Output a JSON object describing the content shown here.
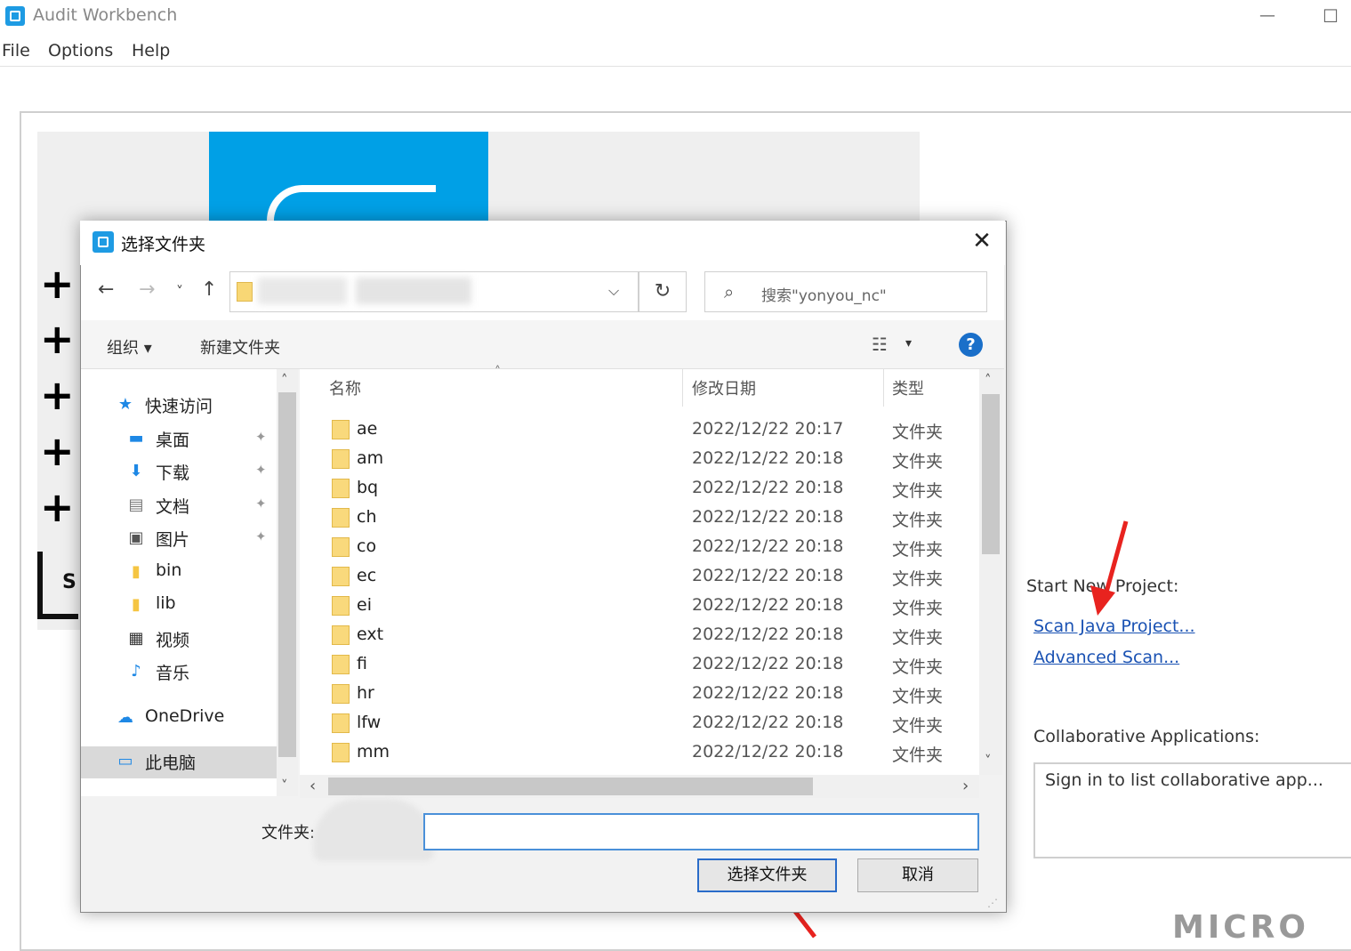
{
  "app": {
    "title": "Audit Workbench",
    "minimize": "—",
    "maximize": "☐"
  },
  "menu": [
    "File",
    "Options",
    "Help"
  ],
  "start_panel": {
    "plus_icons": [
      "+",
      "+",
      "+",
      "+",
      "+"
    ],
    "bracket_letter": "S",
    "start_new_label": "Start New Project:",
    "scan_java_link": "Scan Java Project...",
    "advanced_scan_link": "Advanced Scan...",
    "collab_label": "Collaborative Applications:",
    "collab_placeholder": "Sign in to list collaborative app...",
    "watermark": "MICRO"
  },
  "dialog": {
    "title": "选择文件夹",
    "close": "✕",
    "nav": {
      "back": "←",
      "forward": "→",
      "recent": "˅",
      "up": "↑",
      "dropdown": "⌵",
      "refresh": "↻"
    },
    "search_placeholder": "搜索\"yonyou_nc\"",
    "search_icon": "⌕",
    "toolbar": {
      "organize": "组织 ▾",
      "new_folder": "新建文件夹",
      "view_icon": "☷",
      "view_dropdown": "▾",
      "help": "?"
    },
    "nav_pane": [
      {
        "icon": "★",
        "label": "快速访问",
        "pinned": false,
        "color": "#1e88e5"
      },
      {
        "icon": "▬",
        "label": "桌面",
        "pinned": true,
        "color": "#1e88e5"
      },
      {
        "icon": "⬇",
        "label": "下载",
        "pinned": true,
        "color": "#1e88e5"
      },
      {
        "icon": "▤",
        "label": "文档",
        "pinned": true,
        "color": "#777777"
      },
      {
        "icon": "▣",
        "label": "图片",
        "pinned": true,
        "color": "#555555"
      },
      {
        "icon": "▮",
        "label": "bin",
        "pinned": false,
        "color": "#f5c542"
      },
      {
        "icon": "▮",
        "label": "lib",
        "pinned": false,
        "color": "#f5c542"
      },
      {
        "icon": "▦",
        "label": "视频",
        "pinned": false,
        "color": "#333333"
      },
      {
        "icon": "♪",
        "label": "音乐",
        "pinned": false,
        "color": "#1e88e5"
      },
      {
        "icon": "☁",
        "label": "OneDrive",
        "pinned": false,
        "color": "#1e88e5"
      },
      {
        "icon": "▭",
        "label": "此电脑",
        "pinned": false,
        "color": "#1e88e5"
      }
    ],
    "pin_glyph": "✦",
    "columns": {
      "name": "名称",
      "date": "修改日期",
      "type": "类型"
    },
    "sort_glyph": "˄",
    "files": [
      {
        "name": "ae",
        "date": "2022/12/22 20:17",
        "type": "文件夹"
      },
      {
        "name": "am",
        "date": "2022/12/22 20:18",
        "type": "文件夹"
      },
      {
        "name": "bq",
        "date": "2022/12/22 20:18",
        "type": "文件夹"
      },
      {
        "name": "ch",
        "date": "2022/12/22 20:18",
        "type": "文件夹"
      },
      {
        "name": "co",
        "date": "2022/12/22 20:18",
        "type": "文件夹"
      },
      {
        "name": "ec",
        "date": "2022/12/22 20:18",
        "type": "文件夹"
      },
      {
        "name": "ei",
        "date": "2022/12/22 20:18",
        "type": "文件夹"
      },
      {
        "name": "ext",
        "date": "2022/12/22 20:18",
        "type": "文件夹"
      },
      {
        "name": "fi",
        "date": "2022/12/22 20:18",
        "type": "文件夹"
      },
      {
        "name": "hr",
        "date": "2022/12/22 20:18",
        "type": "文件夹"
      },
      {
        "name": "lfw",
        "date": "2022/12/22 20:18",
        "type": "文件夹"
      },
      {
        "name": "mm",
        "date": "2022/12/22 20:18",
        "type": "文件夹"
      }
    ],
    "scroll": {
      "up": "˄",
      "down": "˅",
      "left": "‹",
      "right": "›"
    },
    "folder_label": "文件夹:",
    "folder_value": "",
    "select_button": "选择文件夹",
    "cancel_button": "取消"
  },
  "colors": {
    "accent": "#1e9be3",
    "link": "#1a52b3",
    "annotation_arrow": "#e8231f"
  }
}
